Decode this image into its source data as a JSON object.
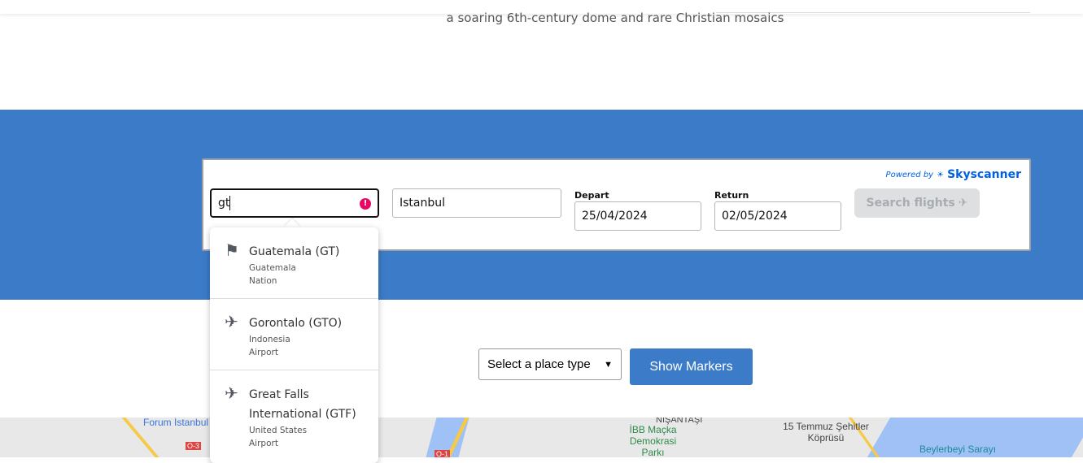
{
  "hero": {
    "subtitle": "a soaring 6th-century dome and rare Christian mosaics"
  },
  "widget": {
    "powered_by": "Powered by",
    "brand": "Skyscanner",
    "from_value": "gt",
    "to_value": "Istanbul",
    "depart_label": "Depart",
    "depart_value": "25/04/2024",
    "return_label": "Return",
    "return_value": "02/05/2024",
    "search_label": "Search flights"
  },
  "dropdown": [
    {
      "icon": "flag-icon",
      "name": "Guatemala (GT)",
      "country": "Guatemala",
      "type": "Nation"
    },
    {
      "icon": "airplane-icon",
      "name": "Gorontalo (GTO)",
      "country": "Indonesia",
      "type": "Airport"
    },
    {
      "icon": "airplane-icon",
      "name": "Great Falls International (GTF)",
      "country": "United States",
      "type": "Airport"
    }
  ],
  "controls": {
    "place_type": "Select a place type",
    "show_markers": "Show Markers"
  },
  "map": {
    "labels": [
      "Forum İstanbul",
      "NİŞANTAŞI",
      "İBB Maçka Demokrasi Parkı",
      "15 Temmuz Şehitler Köprüsü",
      "Beylerbeyi Sarayı",
      "O-3",
      "O-1"
    ]
  },
  "colors": {
    "brand": "#3b7bc8",
    "skyscanner": "#0062e3",
    "error": "#e70866"
  }
}
